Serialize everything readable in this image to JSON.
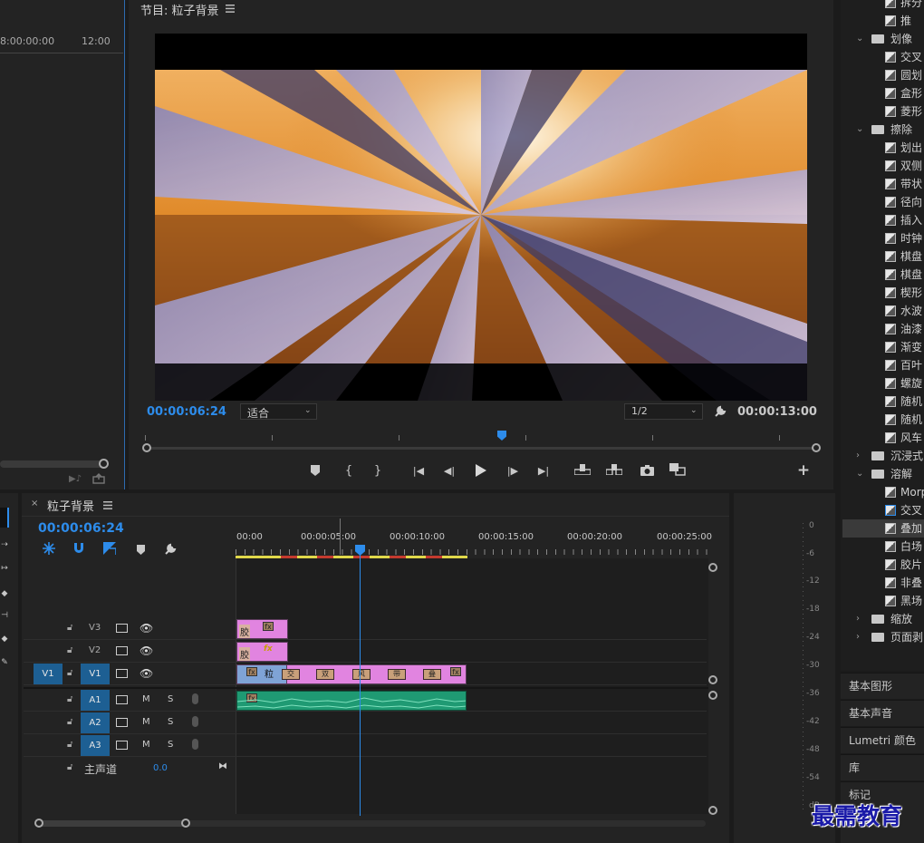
{
  "source_panel": {
    "timecode_left": "8:00:00:00",
    "timecode_right": "12:00"
  },
  "program": {
    "title": "节目: 粒子背景",
    "menu_icon": "hamburger-icon",
    "current_time": "00:00:06:24",
    "fit_select": "适合",
    "resolution_select": "1/2",
    "duration": "00:00:13:00"
  },
  "timeline": {
    "tab_title": "粒子背景",
    "current_time": "00:00:06:24",
    "ruler": [
      "00:00",
      "00:00:05:00",
      "00:00:10:00",
      "00:00:15:00",
      "00:00:20:00",
      "00:00:25:00"
    ],
    "tracks": {
      "v3": "V3",
      "v2": "V2",
      "v1_source": "V1",
      "v1": "V1",
      "a1": "A1",
      "a2": "A2",
      "a3": "A3",
      "master": "主声道",
      "master_value": "0.0",
      "mute": "M",
      "solo": "S"
    },
    "clips": {
      "v3_label": "胶",
      "v2_label": "胶",
      "v2_fx": "fx",
      "v1_label": "粒",
      "fx": "fx",
      "transitions": [
        "交",
        "双",
        "风",
        "带",
        "叠"
      ]
    }
  },
  "meter": {
    "ticks": [
      "0",
      "-6",
      "-12",
      "-18",
      "-24",
      "-30",
      "-36",
      "-42",
      "-48",
      "-54",
      "dB"
    ]
  },
  "effects": {
    "items": [
      {
        "type": "effect",
        "label": "拆分"
      },
      {
        "type": "effect",
        "label": "推"
      },
      {
        "type": "folder",
        "label": "划像"
      },
      {
        "type": "effect",
        "label": "交叉"
      },
      {
        "type": "effect",
        "label": "圆划"
      },
      {
        "type": "effect",
        "label": "盒形"
      },
      {
        "type": "effect",
        "label": "菱形"
      },
      {
        "type": "folder",
        "label": "擦除"
      },
      {
        "type": "effect",
        "label": "划出"
      },
      {
        "type": "effect",
        "label": "双侧"
      },
      {
        "type": "effect",
        "label": "带状"
      },
      {
        "type": "effect",
        "label": "径向"
      },
      {
        "type": "effect",
        "label": "插入"
      },
      {
        "type": "effect",
        "label": "时钟"
      },
      {
        "type": "effect",
        "label": "棋盘"
      },
      {
        "type": "effect",
        "label": "棋盘"
      },
      {
        "type": "effect",
        "label": "楔形"
      },
      {
        "type": "effect",
        "label": "水波"
      },
      {
        "type": "effect",
        "label": "油漆"
      },
      {
        "type": "effect",
        "label": "渐变"
      },
      {
        "type": "effect",
        "label": "百叶"
      },
      {
        "type": "effect",
        "label": "螺旋"
      },
      {
        "type": "effect",
        "label": "随机"
      },
      {
        "type": "effect",
        "label": "随机"
      },
      {
        "type": "effect",
        "label": "风车"
      },
      {
        "type": "folder-closed",
        "label": "沉浸式"
      },
      {
        "type": "folder",
        "label": "溶解"
      },
      {
        "type": "effect",
        "label": "Morph"
      },
      {
        "type": "effect",
        "label": "交叉"
      },
      {
        "type": "effect",
        "label": "叠加",
        "selected": true
      },
      {
        "type": "effect",
        "label": "白场"
      },
      {
        "type": "effect",
        "label": "胶片"
      },
      {
        "type": "effect",
        "label": "非叠"
      },
      {
        "type": "effect",
        "label": "黑场"
      },
      {
        "type": "folder-closed",
        "label": "缩放"
      },
      {
        "type": "folder-closed",
        "label": "页面剥"
      }
    ],
    "side_tabs": [
      "基本图形",
      "基本声音",
      "Lumetri 颜色",
      "库",
      "标记"
    ]
  },
  "watermark": "最需教育",
  "colors": {
    "accent_blue": "#2d8ceb",
    "clip_pink": "#e184e0",
    "clip_blue": "#7fa3d6",
    "audio_green": "#1f9a73",
    "work_area_yellow": "#e0d84a"
  }
}
